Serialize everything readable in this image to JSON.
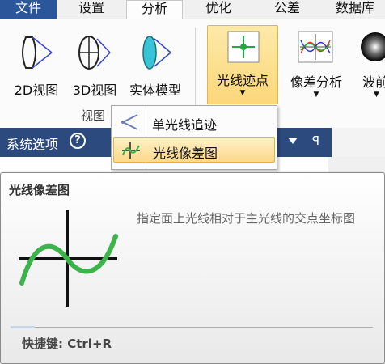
{
  "tabs": {
    "file": "文件",
    "settings": "设置",
    "analysis": "分析",
    "optimize": "优化",
    "tolerance": "公差",
    "database": "数据库"
  },
  "ribbon": {
    "b2d": "2D视图",
    "b3d": "3D视图",
    "solid": "实体模型",
    "spot": "光线迹点",
    "aberration": "像差分析",
    "wave": "波前",
    "group_label": "视图"
  },
  "menu": {
    "single_trace": "单光线追迹",
    "ray_fan": "光线像差图"
  },
  "sidepanel": {
    "title": "系统选项",
    "help": "?",
    "pin": "ꟼ"
  },
  "tooltip": {
    "title": "光线像差图",
    "description": "指定面上光线相对于主光线的交点坐标图",
    "shortcut": "快捷键: Ctrl+R"
  },
  "colors": {
    "accent": "#2b579a",
    "highlight": "#fcd98b",
    "panel_header": "#2c4a7e",
    "curve_green": "#3cb44b"
  }
}
